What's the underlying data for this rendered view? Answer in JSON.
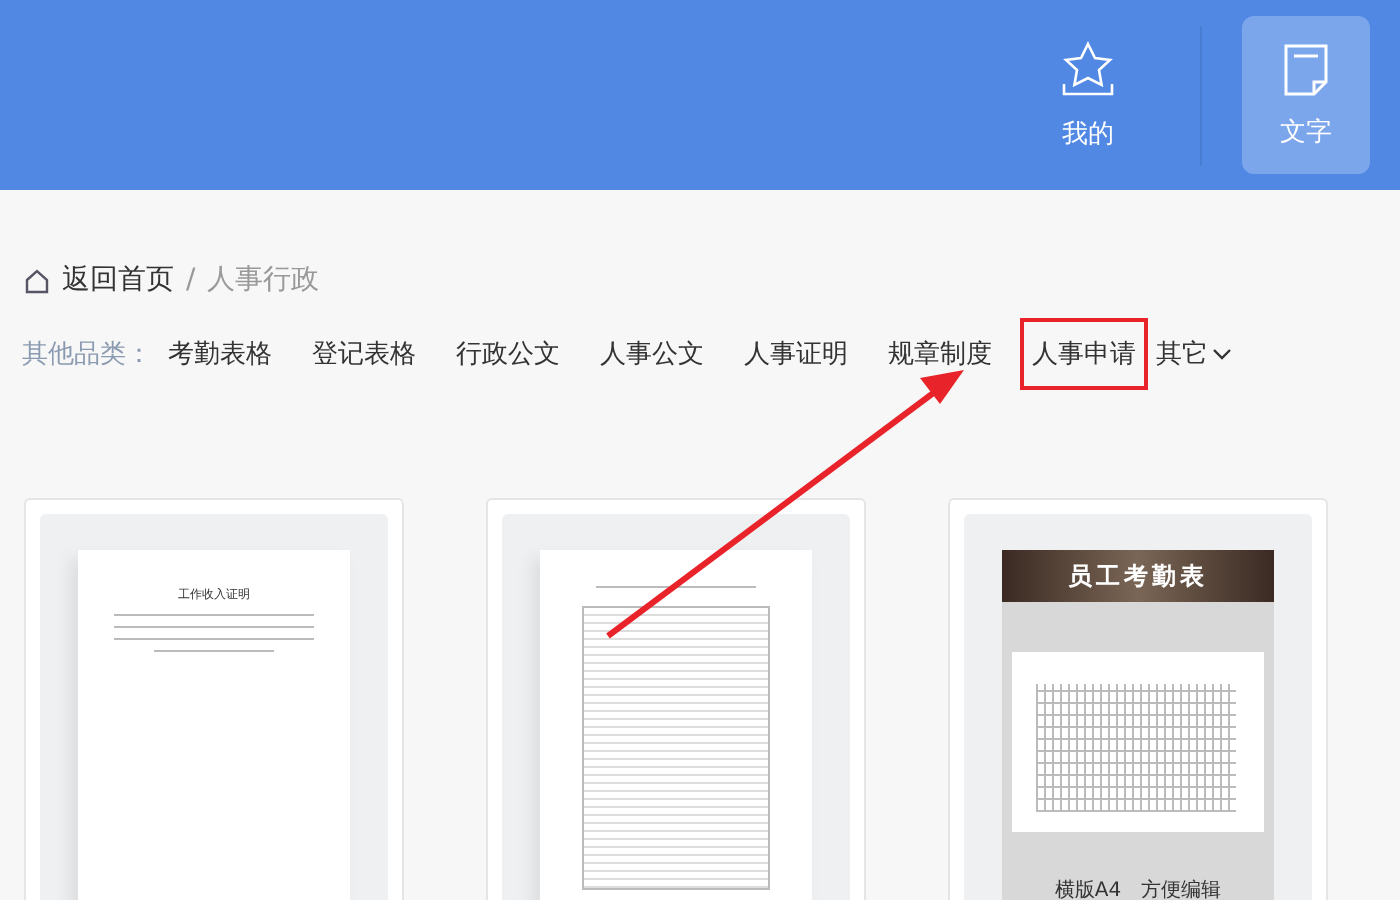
{
  "header": {
    "nav": [
      {
        "label": "我的",
        "kind": "favorites",
        "selected": false
      },
      {
        "label": "文字",
        "kind": "text",
        "selected": true
      }
    ]
  },
  "breadcrumb": {
    "home": "返回首页",
    "separator": "/",
    "current": "人事行政"
  },
  "categories": {
    "label": "其他品类：",
    "items": [
      {
        "label": "考勤表格",
        "highlighted": false
      },
      {
        "label": "登记表格",
        "highlighted": false
      },
      {
        "label": "行政公文",
        "highlighted": false
      },
      {
        "label": "人事公文",
        "highlighted": false
      },
      {
        "label": "人事证明",
        "highlighted": false
      },
      {
        "label": "规章制度",
        "highlighted": false
      },
      {
        "label": "人事申请",
        "highlighted": true
      }
    ],
    "more": "其它"
  },
  "cards": [
    {
      "kind": "letter",
      "title": "工作收入证明"
    },
    {
      "kind": "table"
    },
    {
      "kind": "poster",
      "title": "员工考勤表",
      "caption": "横版A4　方便编辑"
    }
  ]
}
